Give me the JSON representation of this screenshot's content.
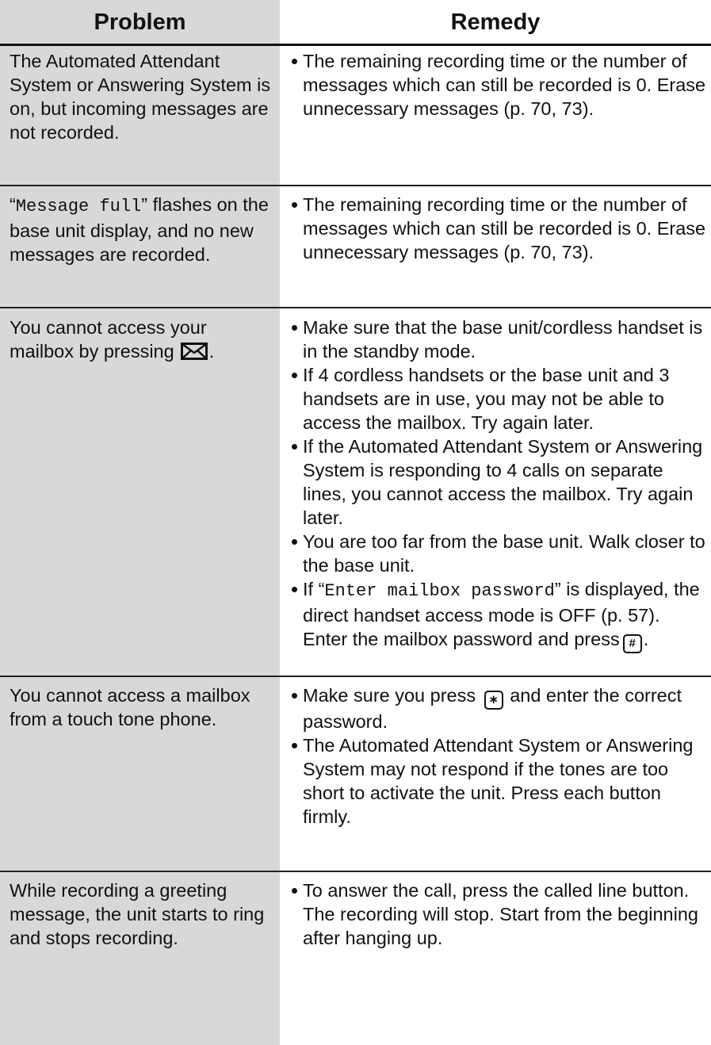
{
  "header": {
    "problem": "Problem",
    "remedy": "Remedy"
  },
  "rows": [
    {
      "problem": "The Automated Attendant System or Answering System is on, but incoming messages are not recorded.",
      "remedies": [
        "The remaining recording time or the number of messages which can still be recorded is 0. Erase unnecessary messages (p. 70, 73)."
      ]
    },
    {
      "problem_pre": "“",
      "problem_mono": "Message full",
      "problem_post": "” flashes on the base unit display, and no new messages are recorded.",
      "remedies": [
        "The remaining recording time or the number of messages which can still be recorded is 0. Erase unnecessary messages (p. 70, 73)."
      ]
    },
    {
      "problem_pre": "You cannot access your mailbox by pressing",
      "problem_icon": "mailbox-envelope-icon",
      "problem_post": ".",
      "remedies": [
        "Make sure that the base unit/cordless handset is in the standby mode.",
        "If 4 cordless handsets or the base unit and 3 handsets are in use, you may not be able to access the mailbox. Try again later.",
        "If the Automated Attendant System or Answering System is responding to 4 calls on separate lines, you cannot access the mailbox. Try again later.",
        "You are too far from the base unit. Walk closer to the base unit."
      ],
      "remedy5": {
        "pre": "If “",
        "mono": "Enter mailbox password",
        "mid": "” is displayed, the direct handset access mode is OFF (p. 57). Enter the mailbox password and press",
        "key": "#",
        "post": "."
      }
    },
    {
      "problem": "You cannot access a mailbox from a touch tone phone.",
      "remedy1": {
        "pre": "Make sure you press",
        "key": "∗",
        "post": "and enter the correct password."
      },
      "remedies": [
        "The Automated Attendant System or Answering System may not respond if the tones are too short to activate the unit. Press each button firmly."
      ]
    },
    {
      "problem": "While recording a greeting message, the unit starts to ring and stops recording.",
      "remedies": [
        "To answer the call, press the called line button. The recording will stop. Start from the beginning after hanging up."
      ]
    }
  ]
}
